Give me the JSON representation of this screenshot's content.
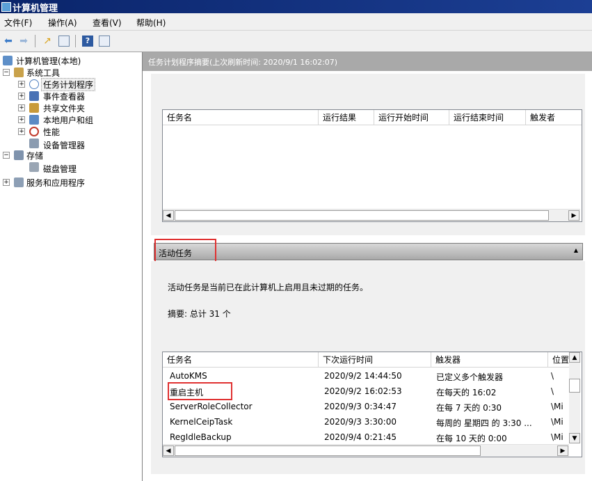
{
  "window": {
    "title": "计算机管理"
  },
  "menu": [
    "文件(F)",
    "操作(A)",
    "查看(V)",
    "帮助(H)"
  ],
  "toolbar_icons": [
    "back-arrow-icon",
    "forward-arrow-icon",
    "up-folder-icon",
    "show-hide-tree-icon",
    "help-icon",
    "console-tree-icon"
  ],
  "tree": {
    "root": "计算机管理(本地)",
    "system_tools": "系统工具",
    "task_scheduler": "任务计划程序",
    "event_viewer": "事件查看器",
    "shared_folders": "共享文件夹",
    "local_users": "本地用户和组",
    "performance": "性能",
    "device_manager": "设备管理器",
    "storage": "存储",
    "disk_management": "磁盘管理",
    "services_apps": "服务和应用程序"
  },
  "header": {
    "text": "任务计划程序摘要(上次刷新时间: 2020/9/1 16:02:07)"
  },
  "top_grid": {
    "columns": [
      "任务名",
      "运行结果",
      "运行开始时间",
      "运行结束时间",
      "触发者"
    ]
  },
  "active_section": {
    "title": "活动任务",
    "description": "活动任务是当前已在此计算机上启用且未过期的任务。",
    "summary": "摘要: 总计 31 个"
  },
  "active_grid": {
    "columns": [
      "任务名",
      "下次运行时间",
      "触发器",
      "位置"
    ],
    "rows": [
      [
        "AutoKMS",
        "2020/9/2 14:44:50",
        "已定义多个触发器",
        "\\"
      ],
      [
        "重启主机",
        "2020/9/2 16:02:53",
        "在每天的 16:02",
        "\\"
      ],
      [
        "ServerRoleCollector",
        "2020/9/3 0:34:47",
        "在每 7 天的 0:30",
        "\\Mi"
      ],
      [
        "KernelCeipTask",
        "2020/9/3 3:30:00",
        "每周的 星期四 的 3:30 ...",
        "\\Mi"
      ],
      [
        "RegIdleBackup",
        "2020/9/4 0:21:45",
        "在每 10 天的 0:00",
        "\\Mi"
      ]
    ]
  },
  "colors": {
    "title_bar": "#0a246a",
    "highlight_box": "#e03030",
    "header_bar": "#a9a9a9"
  }
}
